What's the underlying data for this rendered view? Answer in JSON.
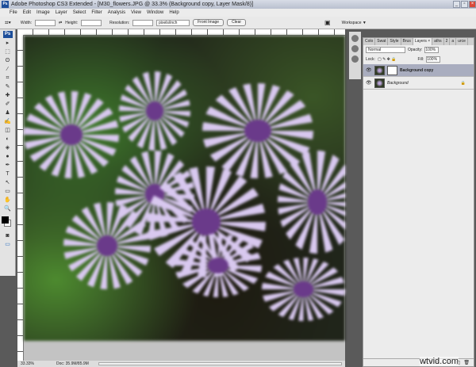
{
  "window": {
    "title": "Adobe Photoshop CS3 Extended - [M30_flowers.JPG @ 33.3% (Background copy, Layer Mask/8)]",
    "app_icon": "Ps"
  },
  "menu": [
    "File",
    "Edit",
    "Image",
    "Layer",
    "Select",
    "Filter",
    "Analysis",
    "View",
    "Window",
    "Help"
  ],
  "options": {
    "width_label": "Width:",
    "height_label": "Height:",
    "resolution_label": "Resolution:",
    "units": "pixels/inch",
    "front_image": "Front Image",
    "clear": "Clear",
    "workspace": "Workspace ▼"
  },
  "tools": [
    "▸",
    "⬚",
    "ʘ",
    "⁄",
    "⌗",
    "✎",
    "✚",
    "✐",
    "♟",
    "✍",
    "◫",
    "◐",
    "◈",
    "●",
    "✒",
    "T",
    "↖",
    "▭",
    "✋",
    "🔍"
  ],
  "status": {
    "zoom": "33.33%",
    "doc": "Doc: 35.9M/85.9M"
  },
  "layers_panel": {
    "tabs": [
      "Colo",
      "Swat",
      "Style",
      "Brus",
      "Layers ×",
      "aths",
      "2",
      "a",
      "urce"
    ],
    "blend_mode": "Normal",
    "opacity_label": "Opacity:",
    "opacity": "100%",
    "lock_label": "Lock:",
    "fill_label": "Fill:",
    "fill": "100%",
    "layers": [
      {
        "name": "Background copy",
        "selected": true,
        "has_mask": true
      },
      {
        "name": "Background",
        "selected": false,
        "locked": true
      }
    ]
  },
  "watermark": "wtvid.com"
}
